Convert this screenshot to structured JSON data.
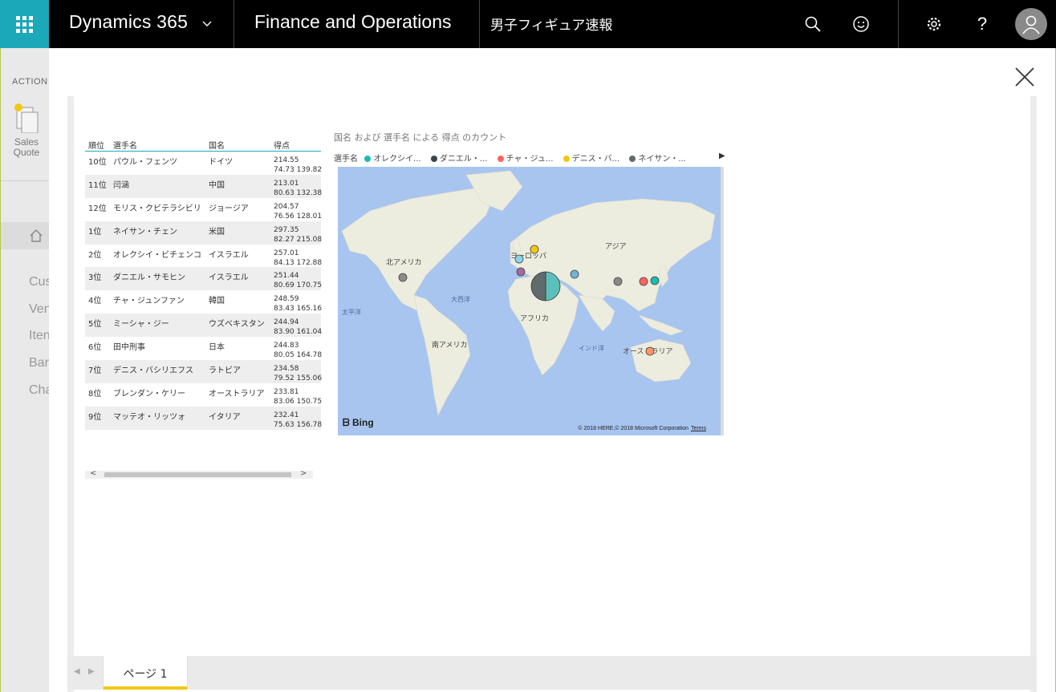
{
  "topbar": {
    "app_name": "Dynamics 365",
    "module": "Finance and Operations",
    "report_title": "男子フィギュア速報"
  },
  "background": {
    "actions_label": "ACTION",
    "sales_quote_label": "Sales\nQuote",
    "nav_items": [
      "Cus",
      "Ven",
      "Iten",
      "Ban",
      "Cha"
    ]
  },
  "table": {
    "headers": {
      "rank": "順位",
      "name": "選手名",
      "country": "国名",
      "score": "得点"
    },
    "rows": [
      {
        "rank": "10位",
        "name": "パウル・フェンツ",
        "country": "ドイツ",
        "score": "214.55",
        "detail": "74.73 139.82"
      },
      {
        "rank": "11位",
        "name": "闫涵",
        "country": "中国",
        "score": "213.01",
        "detail": "80.63 132.38"
      },
      {
        "rank": "12位",
        "name": "モリス・クビテラシビリ",
        "country": "ジョージア",
        "score": "204.57",
        "detail": "76.56 128.01"
      },
      {
        "rank": "1位",
        "name": "ネイサン・チェン",
        "country": "米国",
        "score": "297.35",
        "detail": "82.27 215.08"
      },
      {
        "rank": "2位",
        "name": "オレクシイ・ビチェンコ",
        "country": "イスラエル",
        "score": "257.01",
        "detail": "84.13 172.88"
      },
      {
        "rank": "3位",
        "name": "ダニエル・サモヒン",
        "country": "イスラエル",
        "score": "251.44",
        "detail": "80.69 170.75"
      },
      {
        "rank": "4位",
        "name": "チャ・ジュンファン",
        "country": "韓国",
        "score": "248.59",
        "detail": "83.43 165.16"
      },
      {
        "rank": "5位",
        "name": "ミーシャ・ジー",
        "country": "ウズベキスタン",
        "score": "244.94",
        "detail": "83.90 161.04"
      },
      {
        "rank": "6位",
        "name": "田中刑事",
        "country": "日本",
        "score": "244.83",
        "detail": "80.05 164.78"
      },
      {
        "rank": "7位",
        "name": "デニス・バシリエフス",
        "country": "ラトビア",
        "score": "234.58",
        "detail": "79.52 155.06"
      },
      {
        "rank": "8位",
        "name": "ブレンダン・ケリー",
        "country": "オーストラリア",
        "score": "233.81",
        "detail": "83.06 150.75"
      },
      {
        "rank": "9位",
        "name": "マッテオ・リッツォ",
        "country": "イタリア",
        "score": "232.41",
        "detail": "75.63 156.78"
      }
    ]
  },
  "map": {
    "title": "国名 および 選手名 による 得点 のカウント",
    "legend_label": "選手名",
    "legend": [
      {
        "name": "オレクシイ...",
        "color": "#1bbcb0"
      },
      {
        "name": "ダニエル・...",
        "color": "#374649"
      },
      {
        "name": "チャ・ジュ...",
        "color": "#fd625e"
      },
      {
        "name": "デニス・バ...",
        "color": "#f2c80f"
      },
      {
        "name": "ネイサン・...",
        "color": "#5f6b6d"
      }
    ],
    "labels": {
      "north_america": "北アメリカ",
      "europe": "ヨーロッパ",
      "asia": "アジア",
      "pacific": "太平洋",
      "atlantic": "大西洋",
      "africa": "アフリカ",
      "south_america": "南アメリカ",
      "indian_ocean": "インド洋",
      "australia": "オーストラリア"
    },
    "bing": "Bing",
    "copyright": "© 2018 HERE,© 2018 Microsoft Corporation",
    "terms": "Terms"
  },
  "pages": {
    "active_tab": "ページ 1"
  }
}
